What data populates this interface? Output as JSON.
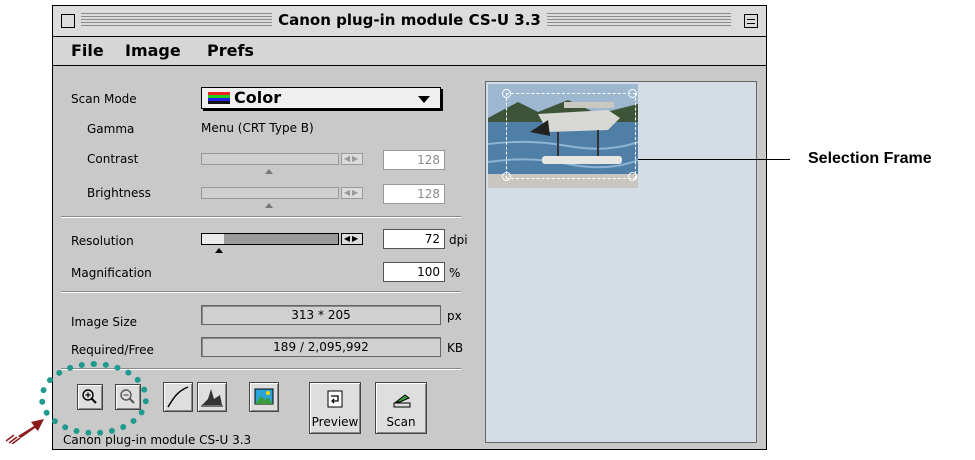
{
  "window": {
    "title": "Canon plug-in module CS-U 3.3"
  },
  "menu": [
    "File",
    "Image",
    "Prefs"
  ],
  "scan_mode": {
    "label": "Scan Mode",
    "value": "Color"
  },
  "gamma": {
    "label": "Gamma",
    "value": "Menu (CRT Type B)"
  },
  "contrast": {
    "label": "Contrast",
    "value": "128"
  },
  "brightness": {
    "label": "Brightness",
    "value": "128"
  },
  "resolution": {
    "label": "Resolution",
    "value": "72",
    "unit": "dpi"
  },
  "magnification": {
    "label": "Magnification",
    "value": "100",
    "unit": "%"
  },
  "image_size": {
    "label": "Image Size",
    "value": "313 * 205",
    "unit": "px"
  },
  "required_free": {
    "label": "Required/Free",
    "value": "189 / 2,095,992",
    "unit": "KB"
  },
  "buttons": {
    "preview": "Preview",
    "scan": "Scan"
  },
  "status": "Canon plug-in module CS-U 3.3",
  "callout": "Selection Frame",
  "colors": {
    "highlight": "#1f9a8e",
    "pointer": "#8b1a1a",
    "window_bg": "#c9c9c9"
  },
  "icons": [
    "zoom-in-icon",
    "zoom-out-icon",
    "tone-curve-icon",
    "histogram-icon",
    "image-adjust-icon",
    "preview-icon",
    "scan-icon"
  ]
}
